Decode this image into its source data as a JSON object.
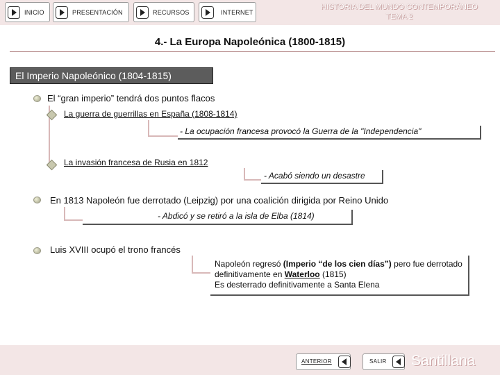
{
  "nav": {
    "inicio": "INICIO",
    "presentacion": "PRESENTACIÓN",
    "recursos": "RECURSOS",
    "internet": "INTERNET"
  },
  "header": {
    "line1": "HISTORIA DEL MUNDO CONTEMPORÁNEO",
    "line2": "TEMA 2"
  },
  "section_title": "4.- La Europa Napoleónica (1800-1815)",
  "subtitle": "El Imperio Napoleónico (1804-1815)",
  "points": {
    "p1": "El “gran imperio” tendrá dos puntos flacos",
    "p1_a": "La guerra de guerrillas en España (1808-1814)",
    "p1_a_note": "- La ocupación francesa provocó la Guerra de la \"Independencia\"",
    "p1_b": "La invasión francesa de Rusia en 1812",
    "p1_b_note": "- Acabó siendo un desastre",
    "p2": "En 1813 Napoleón fue derrotado (Leipzig) por una coalición dirigida por Reino Unido",
    "p2_note": "- Abdicó y se retiró a la isla de Elba (1814)",
    "p3": "Luis XVIII ocupó el trono francés",
    "p3_note": {
      "pre": "Napoleón regresó ",
      "bold1": "(Imperio “de los cien días”)",
      "mid": " pero fue derrotado definitivamente en ",
      "bold2": "Waterloo",
      "post": " (1815)",
      "line2": "Es desterrado definitivamente a Santa Elena"
    }
  },
  "footer": {
    "anterior": "ANTERIOR",
    "salir": "SALIR",
    "brand": "Santillana"
  },
  "colors": {
    "bar_bg": "#f3e6e6",
    "subtitle_bg": "#5c5c5c",
    "connector": "#d8b8b8"
  },
  "icons": {
    "nav": "play-arrow-icon",
    "footer_back": "back-arrow-icon",
    "footer_exit": "back-arrow-icon"
  }
}
